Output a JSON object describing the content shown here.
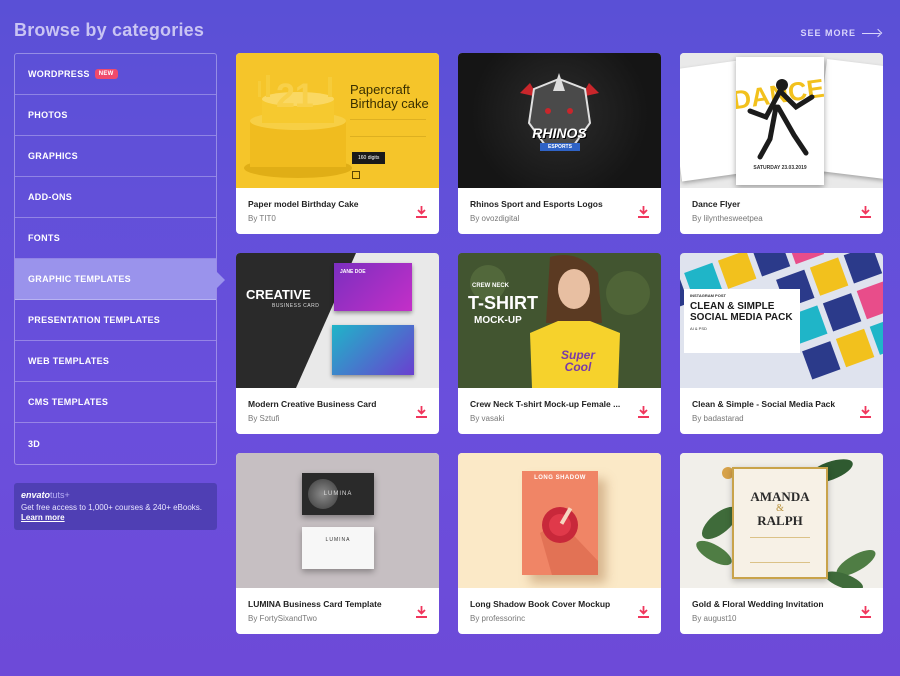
{
  "header": {
    "title": "Browse by categories",
    "see_more": "SEE MORE"
  },
  "sidebar": {
    "items": [
      {
        "label": "WORDPRESS",
        "badge": "NEW",
        "active": false
      },
      {
        "label": "PHOTOS",
        "active": false
      },
      {
        "label": "GRAPHICS",
        "active": false
      },
      {
        "label": "ADD-ONS",
        "active": false
      },
      {
        "label": "FONTS",
        "active": false
      },
      {
        "label": "GRAPHIC TEMPLATES",
        "active": true
      },
      {
        "label": "PRESENTATION TEMPLATES",
        "active": false
      },
      {
        "label": "WEB TEMPLATES",
        "active": false
      },
      {
        "label": "CMS TEMPLATES",
        "active": false
      },
      {
        "label": "3D",
        "active": false
      }
    ]
  },
  "promo": {
    "brand": "envato",
    "suffix": "tuts+",
    "text": "Get free access to 1,000+ courses & 240+ eBooks.",
    "link": "Learn more"
  },
  "cards": [
    {
      "title": "Paper model Birthday Cake",
      "author": "By TIT0",
      "thumb": {
        "heading": "Papercraft Birthday cake",
        "number": "21",
        "tag": "160 digits"
      }
    },
    {
      "title": "Rhinos Sport and Esports Logos",
      "author": "By ovozdigital",
      "thumb": {
        "logo_text": "RHINOS",
        "logo_sub": "ESPORTS"
      }
    },
    {
      "title": "Dance Flyer",
      "author": "By lilynthesweetpea",
      "thumb": {
        "word": "DANCE",
        "date": "SATURDAY 23.03.2019"
      }
    },
    {
      "title": "Modern Creative Business Card",
      "author": "By Sztufi",
      "thumb": {
        "heading": "CREATIVE",
        "sub": "BUSINESS CARD",
        "name": "JANE DOE"
      }
    },
    {
      "title": "Crew Neck T-shirt Mock-up Female ...",
      "author": "By vasaki",
      "thumb": {
        "line1": "CREW NECK",
        "line2": "T-SHIRT",
        "line3": "MOCK-UP",
        "shirt_text": "Super Cool"
      }
    },
    {
      "title": "Clean & Simple - Social Media Pack",
      "author": "By badastarad",
      "thumb": {
        "tag": "INSTAGRAM POST",
        "heading": "CLEAN & SIMPLE SOCIAL MEDIA PACK",
        "sub": "AI & PSD"
      }
    },
    {
      "title": "LUMINA Business Card Template",
      "author": "By FortySixandTwo",
      "thumb": {
        "brand": "LUMINA"
      }
    },
    {
      "title": "Long Shadow Book Cover Mockup",
      "author": "By professorinc",
      "thumb": {
        "book_title": "LONG SHADOW"
      }
    },
    {
      "title": "Gold & Floral Wedding Invitation",
      "author": "By august10",
      "thumb": {
        "name1": "AMANDA",
        "amp": "&",
        "name2": "RALPH"
      }
    }
  ],
  "colors": {
    "accent": "#f0365c",
    "bg": "#5a50d6",
    "active": "#9a93ec",
    "badge": "#f04a6b"
  }
}
